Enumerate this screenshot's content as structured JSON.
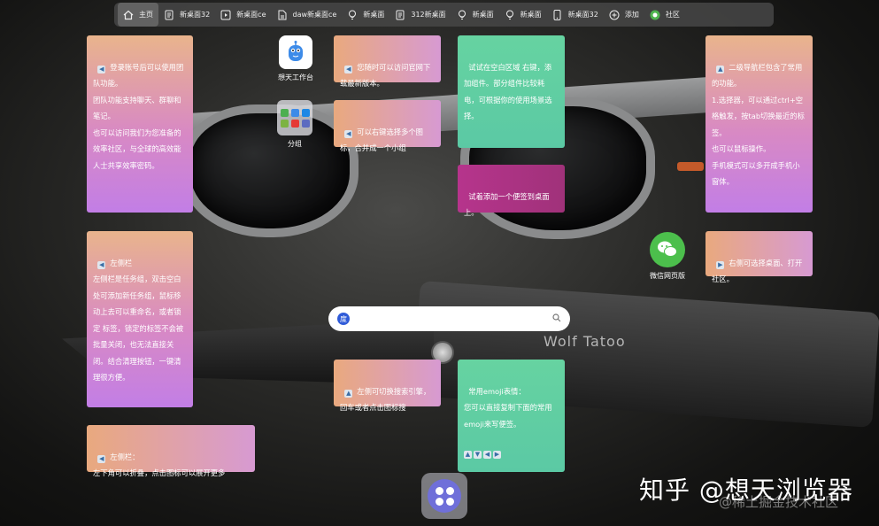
{
  "tabs": [
    {
      "label": "主页",
      "icon": "home-icon",
      "active": true
    },
    {
      "label": "新桌面32",
      "icon": "doc-icon"
    },
    {
      "label": "新桌面ce",
      "icon": "play-icon"
    },
    {
      "label": "daw新桌面ce",
      "icon": "file-icon"
    },
    {
      "label": "新桌面",
      "icon": "bulb-icon"
    },
    {
      "label": "312新桌面",
      "icon": "doc-icon"
    },
    {
      "label": "新桌面",
      "icon": "bulb-icon"
    },
    {
      "label": "新桌面",
      "icon": "bulb-icon"
    },
    {
      "label": "新桌面32",
      "icon": "phone-icon"
    },
    {
      "label": "添加",
      "icon": "plus-icon"
    },
    {
      "label": "社区",
      "icon": "community-icon"
    }
  ],
  "apps": {
    "workbench": {
      "label": "想天工作台",
      "icon": "robot-icon"
    },
    "group": {
      "label": "分组",
      "icon": "group-icon"
    },
    "wechat": {
      "label": "微信网页版",
      "icon": "wechat-icon"
    }
  },
  "notes": {
    "n1": "登录账号后可以使用团队功能。\n团队功能支持聊天、群聊和笔记。\n也可以访问我们为您准备的效率社区，与全球的高效能人士共享效率密码。",
    "n2": "您随时可以访问官网下载最新版本。",
    "n3": "可以右键选择多个图标，合并成一个小组",
    "n4": "试试在空白区域 右键，添加组件。部分组件比较耗电，可根据你的使用场景选择。",
    "n5": "试着添加一个便签到桌面上。",
    "n6": "二级导航栏包含了常用的功能。\n1.选择器，可以通过ctrl+空格触发，按tab切换最近的标签。\n也可以鼠标操作。\n手机模式可以多开成手机小窗体。",
    "n7": "右侧可选择桌面、打开社区。",
    "n8": "左侧栏\n左侧栏是任务组，双击空白处可添加新任务组，鼠标移动上去可以重命名，或者锁定 标签，锁定的标签不会被批量关闭，也无法直接关闭。结合清理按钮，一键清理很方便。",
    "n9": "左侧可切换搜索引擎，回车或者点击图标搜",
    "n10": "常用emoji表情：\n您可以直接复制下面的常用emoji来写便签。",
    "n11": "左侧栏：\n左下角可以折叠，点击图标可以展开更多"
  },
  "search": {
    "placeholder": ""
  },
  "background": {
    "brand_text": "Wolf Tatoo"
  },
  "watermark": {
    "main": "知乎 @想天浏览器",
    "sub": "@稀土掘金技术社区"
  }
}
